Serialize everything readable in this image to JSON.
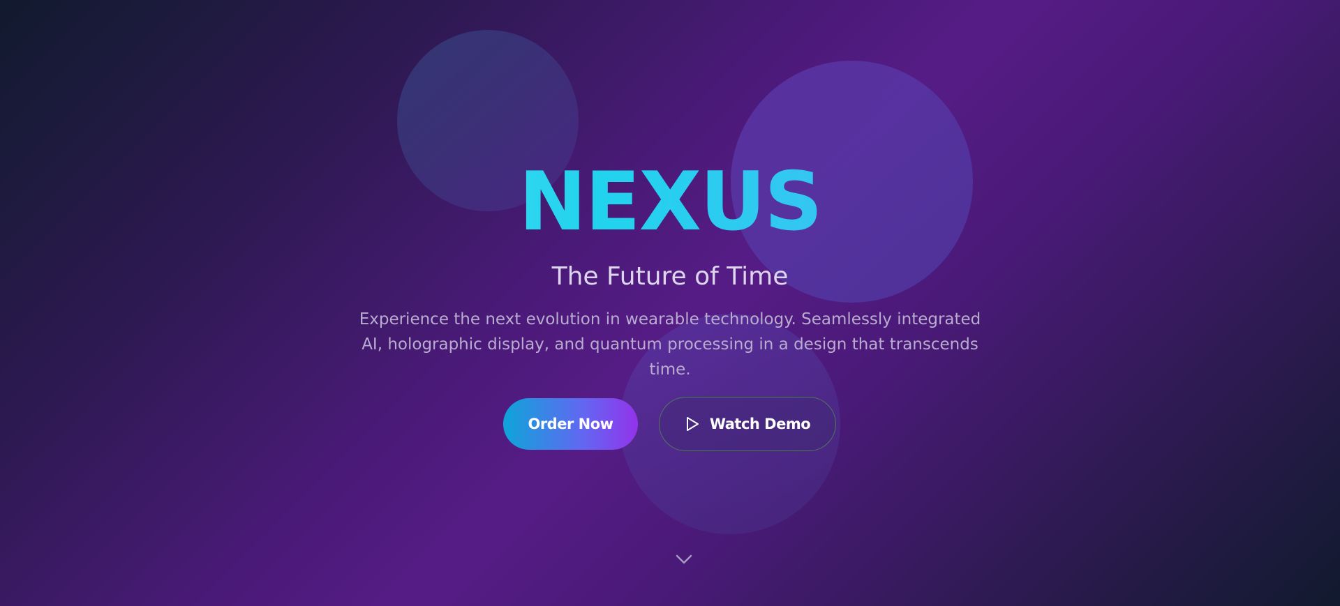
{
  "hero": {
    "brand": "NEXUS",
    "tagline": "The Future of Time",
    "description": "Experience the next evolution in wearable technology. Seamlessly integrated AI, holographic display, and quantum processing in a design that transcends time."
  },
  "actions": {
    "order_label": "Order Now",
    "demo_label": "Watch Demo",
    "demo_icon": "play-icon"
  },
  "scroll": {
    "icon": "chevron-down-icon"
  },
  "colors": {
    "brand_gradient_start": "#6ee7f5",
    "brand_gradient_end": "#60a5fa",
    "order_gradient_start": "#0ea5d9",
    "order_gradient_end": "#9333ea",
    "background_mid": "#561c86",
    "background_corner": "#111a2e"
  }
}
